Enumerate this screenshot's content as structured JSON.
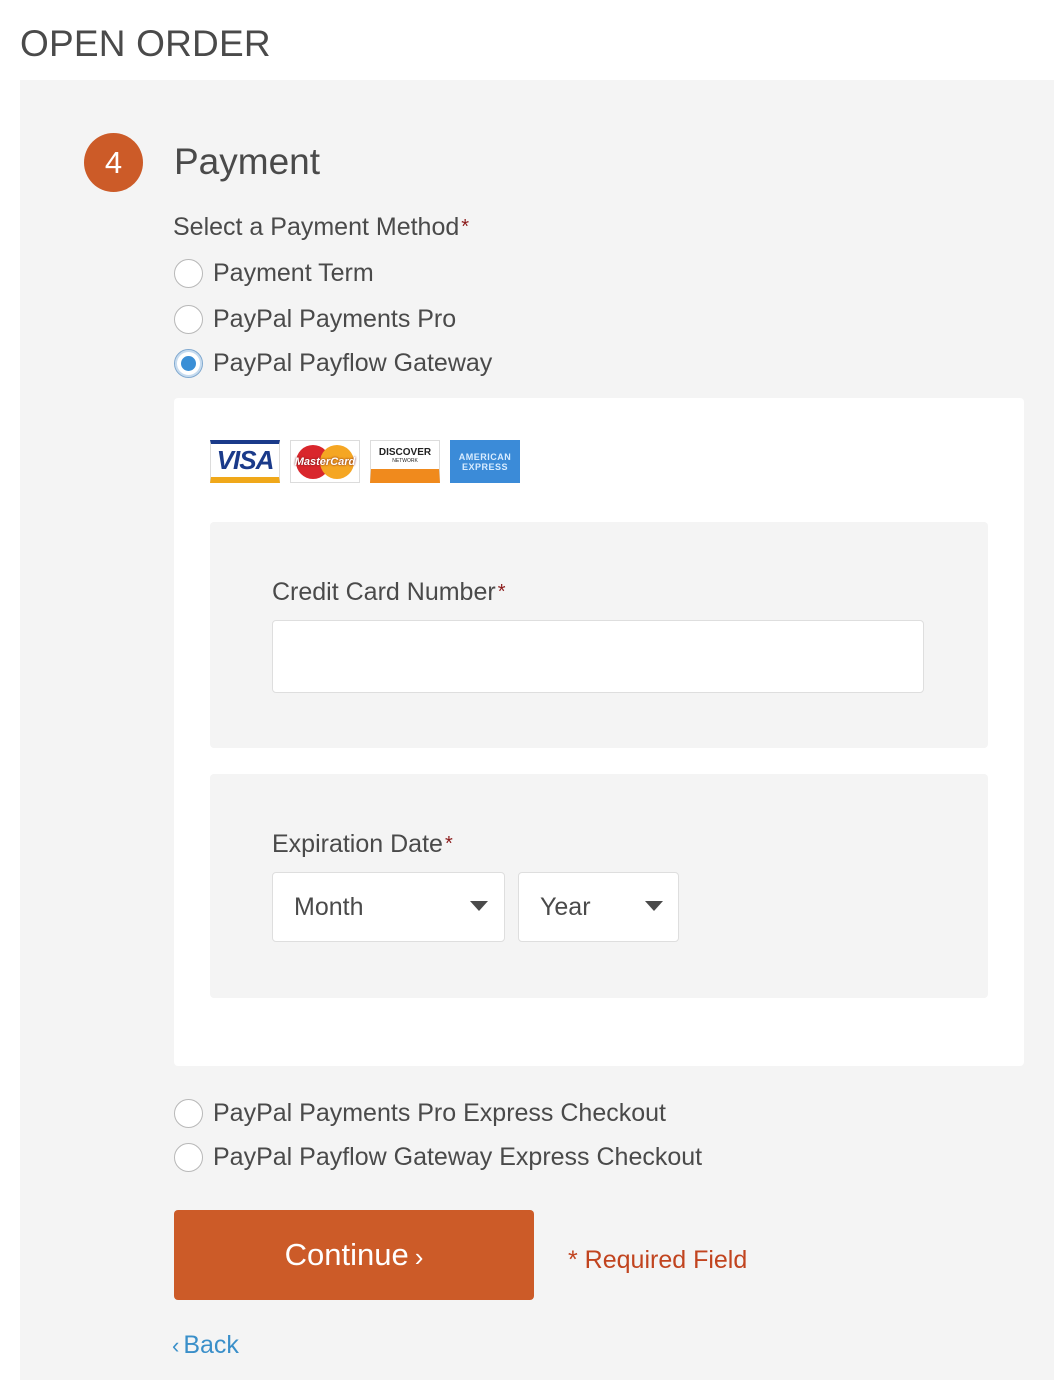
{
  "page": {
    "title": "OPEN ORDER"
  },
  "step": {
    "number": "4",
    "title": "Payment"
  },
  "payment_method": {
    "label": "Select a Payment Method",
    "required_mark": "*",
    "selected": "PayPal Payflow Gateway",
    "options": [
      {
        "label": "Payment Term",
        "checked": false
      },
      {
        "label": "PayPal Payments Pro",
        "checked": false
      },
      {
        "label": "PayPal Payflow Gateway",
        "checked": true
      },
      {
        "label": "PayPal Payments Pro Express Checkout",
        "checked": false
      },
      {
        "label": "PayPal Payflow Gateway Express Checkout",
        "checked": false
      }
    ]
  },
  "card_logos": {
    "visa": "VISA",
    "mastercard": "MasterCard",
    "discover": "DISCOVER",
    "discover_sub": "NETWORK",
    "amex": "AMERICAN EXPRESS"
  },
  "credit_card": {
    "label": "Credit Card Number",
    "required_mark": "*",
    "value": ""
  },
  "expiration": {
    "label": "Expiration Date",
    "required_mark": "*",
    "month_value": "Month",
    "year_value": "Year"
  },
  "actions": {
    "continue_label": "Continue",
    "continue_chevron": "›",
    "required_note": "* Required Field",
    "back_chevron": "‹",
    "back_label": "Back"
  },
  "colors": {
    "accent": "#cc5b28",
    "link": "#3a8fc9",
    "radio_selected": "#3a8fd6",
    "required_text": "#c1441f",
    "required_star": "#8b1a1a",
    "panel_bg": "#f4f4f4"
  }
}
